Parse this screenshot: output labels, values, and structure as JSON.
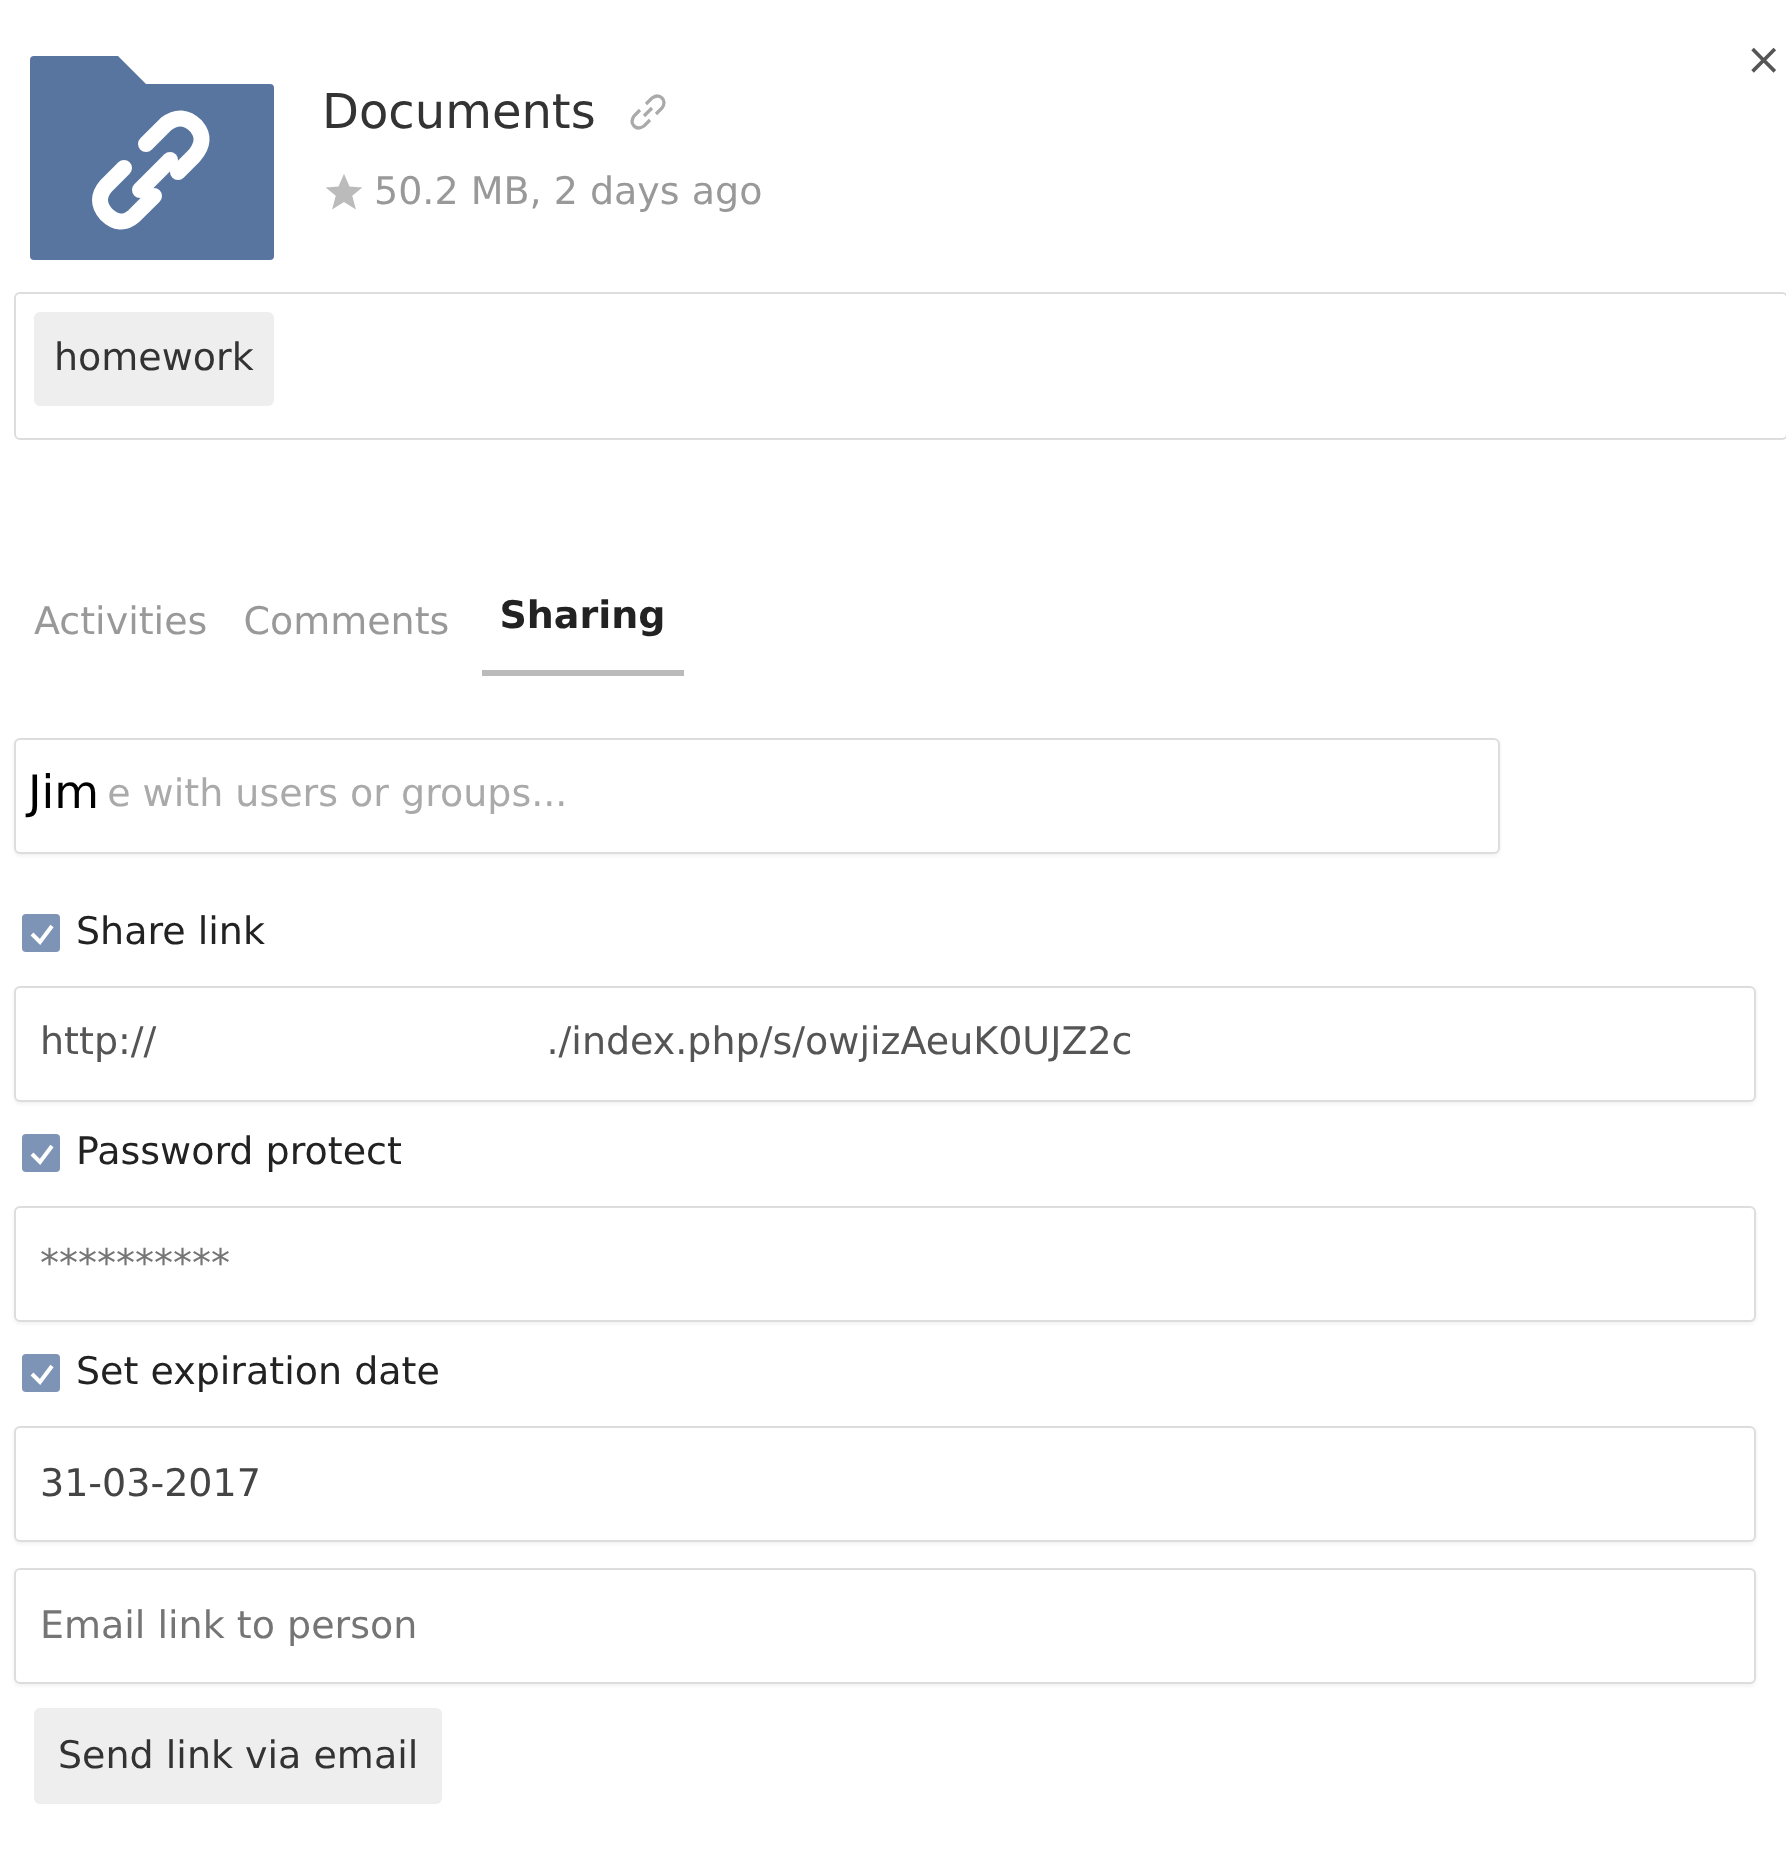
{
  "header": {
    "name": "Documents",
    "starred": false,
    "meta": "50.2 MB, 2 days ago",
    "close": "×"
  },
  "tags": [
    "homework"
  ],
  "tabs": [
    {
      "label": "Activities",
      "selected": false
    },
    {
      "label": "Comments",
      "selected": false
    },
    {
      "label": "Sharing",
      "selected": true
    }
  ],
  "share_field": {
    "value": "Jim",
    "placeholder_visible": "e with users or groups..."
  },
  "options": [
    {
      "kind": "check",
      "label": "Share link",
      "checked": true
    },
    {
      "kind": "link",
      "parts": [
        "http://",
        "./index.php/s/owjizAeuK0UJZ2c"
      ]
    },
    {
      "kind": "check",
      "label": "Password protect",
      "checked": true
    },
    {
      "kind": "password",
      "placeholder": "**********"
    },
    {
      "kind": "check",
      "label": "Set expiration date",
      "checked": true
    },
    {
      "kind": "date",
      "value": "31-03-2017"
    },
    {
      "kind": "gap"
    },
    {
      "kind": "email",
      "placeholder": "Email link to person"
    }
  ],
  "button": "Send link via email"
}
